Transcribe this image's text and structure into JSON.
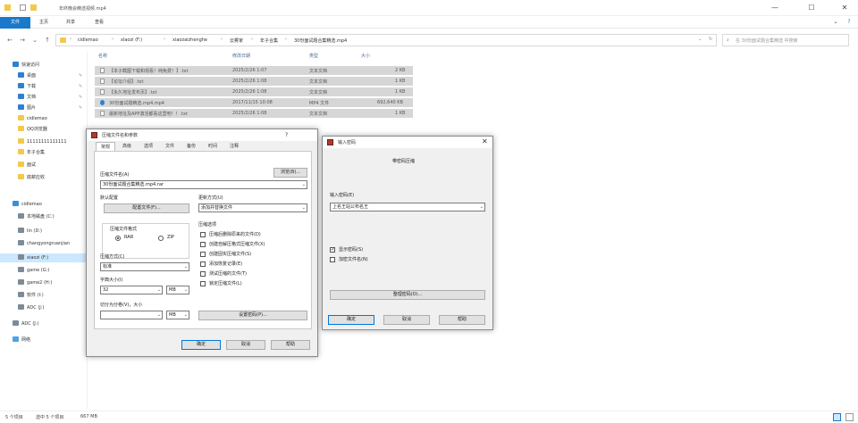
{
  "window": {
    "title": "年终晚会精选视频.mp4",
    "controls": {
      "minimize": "—",
      "maximize": "☐",
      "close": "✕"
    }
  },
  "ribbon": {
    "tabs": [
      "文件",
      "主页",
      "共享",
      "查看"
    ]
  },
  "address": {
    "crumbs": [
      "cidlemao",
      "xlaozi (F:)",
      "xiaozaizhenghe",
      "云雾家",
      "年子合集",
      "30份面试题合集精选.mp4"
    ],
    "search_placeholder": "在 30份面试题合集精选 中搜索"
  },
  "sidebar": {
    "items": [
      {
        "label": "快速访问",
        "icon": "star-icon"
      },
      {
        "label": "桌面",
        "icon": "desktop-icon"
      },
      {
        "label": "下载",
        "icon": "download-icon"
      },
      {
        "label": "文档",
        "icon": "document-icon"
      },
      {
        "label": "图片",
        "icon": "picture-icon"
      },
      {
        "label": "cidlemao",
        "icon": "folder-icon"
      },
      {
        "label": "QQ浏览器",
        "icon": "folder-icon"
      },
      {
        "label": "11111111111111",
        "icon": "folder-icon"
      },
      {
        "label": "年子合集",
        "icon": "folder-icon"
      },
      {
        "label": "面试",
        "icon": "folder-icon"
      },
      {
        "label": "底薪应收",
        "icon": "folder-icon"
      },
      {
        "label": "cidlemao",
        "icon": "pc-icon"
      },
      {
        "label": "本地磁盘 (C:)",
        "icon": "drive-icon"
      },
      {
        "label": "lin (D:)",
        "icon": "drive-icon"
      },
      {
        "label": "changyongruanjian",
        "icon": "drive-icon"
      },
      {
        "label": "xiaozi (F:)",
        "icon": "drive-icon"
      },
      {
        "label": "game (G:)",
        "icon": "drive-icon"
      },
      {
        "label": "game2 (H:)",
        "icon": "drive-icon"
      },
      {
        "label": "软件 (I:)",
        "icon": "drive-icon"
      },
      {
        "label": "ADC (J:)",
        "icon": "drive-icon"
      },
      {
        "label": "ADC (J:)",
        "icon": "drive-icon"
      },
      {
        "label": "网络",
        "icon": "network-icon"
      }
    ]
  },
  "filelist": {
    "columns": [
      "名称",
      "修改日期",
      "类型",
      "大小"
    ],
    "rows": [
      {
        "name": "【本子截图下载和观看！纯免费！】.txt",
        "date": "2025/2/26 1:07",
        "type": "文本文档",
        "size": "2 KB",
        "icon": "txt"
      },
      {
        "name": "【论坛介绍】.txt",
        "date": "2025/2/26 1:08",
        "type": "文本文档",
        "size": "1 KB",
        "icon": "txt"
      },
      {
        "name": "【永久地址发布页】.txt",
        "date": "2025/2/26 1:08",
        "type": "文本文档",
        "size": "1 KB",
        "icon": "txt"
      },
      {
        "name": "30份面试题精选.mp4.mp4",
        "date": "2017/11/15 10:08",
        "type": "MP4 文件",
        "size": "692,640 KB",
        "icon": "mp4"
      },
      {
        "name": "最新地址及APP激活都看这里吧！！.txt",
        "date": "2025/2/26 1:08",
        "type": "文本文档",
        "size": "1 KB",
        "icon": "txt"
      }
    ]
  },
  "status": {
    "count": "5 个项目",
    "selected": "选中 5 个项目",
    "size": "667 MB"
  },
  "compress_dialog": {
    "title": "压缩文件名和参数",
    "close": "?",
    "tabs": [
      "常规",
      "高级",
      "选项",
      "文件",
      "备份",
      "时间",
      "注释"
    ],
    "archive_name_label": "压缩文件名(A)",
    "archive_name_value": "30份面试题合集精选.mp4.rar",
    "browse_button": "浏览(B)...",
    "default_config_label": "默认配置",
    "config_button": "配置文件(F)...",
    "update_mode_label": "更新方式(U)",
    "update_mode_value": "添加并替换文件",
    "format_label": "压缩文件格式",
    "format_rar": "RAR",
    "format_zip": "ZIP",
    "method_label": "压缩方式(C)",
    "method_value": "标准",
    "dict_label": "字典大小(I)",
    "dict_value": "32",
    "dict_unit": "MB",
    "split_label": "切分为分卷(V)，大小",
    "split_unit": "MB",
    "options_label": "压缩选项",
    "options": [
      {
        "label": "压缩后删除原来的文件(D)",
        "checked": false
      },
      {
        "label": "创建自解压格式压缩文件(X)",
        "checked": false
      },
      {
        "label": "创建固实压缩文件(S)",
        "checked": false
      },
      {
        "label": "添加恢复记录(E)",
        "checked": false
      },
      {
        "label": "测试压缩的文件(T)",
        "checked": false
      },
      {
        "label": "锁定压缩文件(L)",
        "checked": false
      }
    ],
    "set_password_button": "设置密码(P)...",
    "ok_button": "确定",
    "cancel_button": "取消",
    "help_button": "帮助"
  },
  "password_dialog": {
    "title": "输入密码",
    "close": "✕",
    "heading": "带密码压缩",
    "password_label": "输入密码(E)",
    "password_value": "上名王站公布名王",
    "show_password_label": "显示密码(S)",
    "show_password_checked": true,
    "encrypt_names_label": "加密文件名(N)",
    "encrypt_names_checked": false,
    "organize_button": "整理密码(O)...",
    "ok_button": "确定",
    "cancel_button": "取消",
    "help_button": "帮助"
  }
}
